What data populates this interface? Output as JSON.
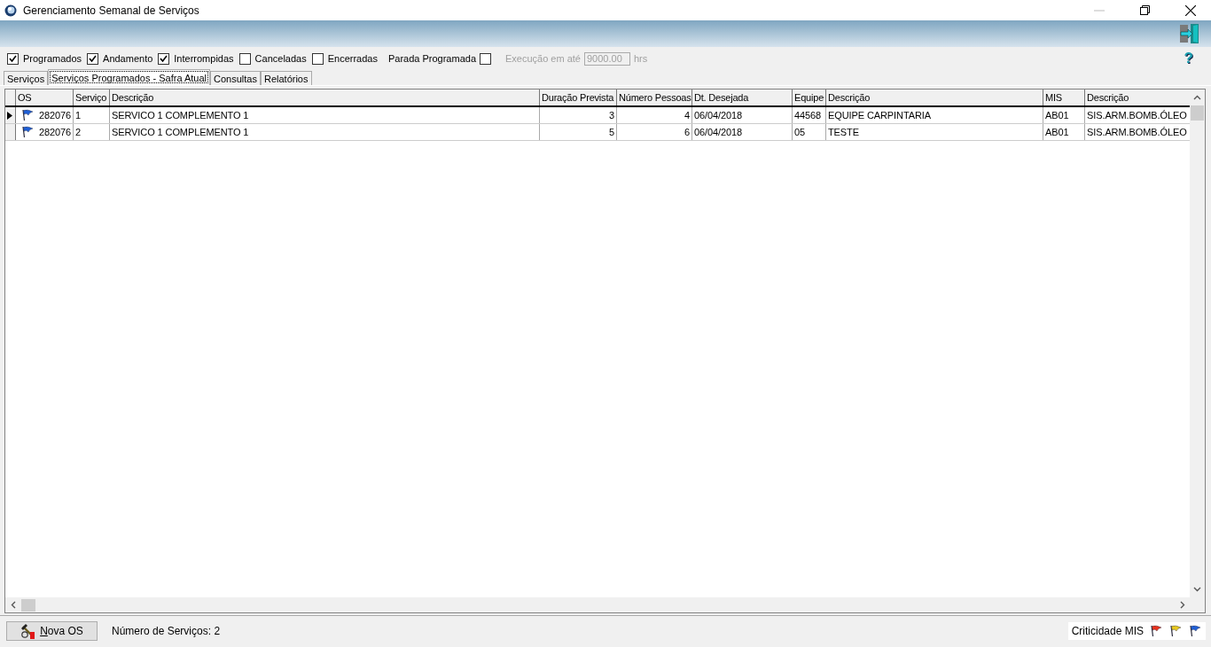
{
  "window": {
    "title": "Gerenciamento Semanal de Serviços"
  },
  "filters": [
    {
      "label": "Programados",
      "checked": true
    },
    {
      "label": "Andamento",
      "checked": true
    },
    {
      "label": "Interrompidas",
      "checked": true
    },
    {
      "label": "Canceladas",
      "checked": false
    },
    {
      "label": "Encerradas",
      "checked": false
    }
  ],
  "parada": {
    "label": "Parada Programada",
    "checked": false
  },
  "execucao": {
    "label": "Execução em até",
    "value": "9000.00",
    "unit": "hrs",
    "disabled": true
  },
  "tabs": [
    {
      "label": "Serviços",
      "selected": false
    },
    {
      "label": "Serviços Programados - Safra Atual",
      "selected": true
    },
    {
      "label": "Consultas",
      "selected": false
    },
    {
      "label": "Relatórios",
      "selected": false
    }
  ],
  "help": "?",
  "table": {
    "columns": [
      "OS",
      "Serviço",
      "Descrição",
      "Duração Prevista",
      "Número Pessoas",
      "Dt. Desejada",
      "Equipe",
      "Descrição",
      "MIS",
      "Descrição"
    ],
    "rows": [
      {
        "selected": true,
        "color": "#1f5fd6",
        "cells": [
          "282076",
          "1",
          "SERVICO 1 COMPLEMENTO 1",
          "3",
          "4",
          "06/04/2018",
          "44568",
          "EQUIPE CARPINTARIA",
          "AB01",
          "SIS.ARM.BOMB.ÓLEO"
        ]
      },
      {
        "selected": false,
        "color": "#1f5fd6",
        "cells": [
          "282076",
          "2",
          "SERVICO 1 COMPLEMENTO 1",
          "5",
          "6",
          "06/04/2018",
          "05",
          "TESTE",
          "AB01",
          "SIS.ARM.BOMB.ÓLEO"
        ]
      }
    ]
  },
  "footer": {
    "button": "Nova OS",
    "count": "Número de Serviços: 2",
    "legend": "Criticidade MIS",
    "flags": [
      {
        "color": "#e8321e"
      },
      {
        "color": "#e8c81e"
      },
      {
        "color": "#1f5fd6"
      }
    ]
  }
}
